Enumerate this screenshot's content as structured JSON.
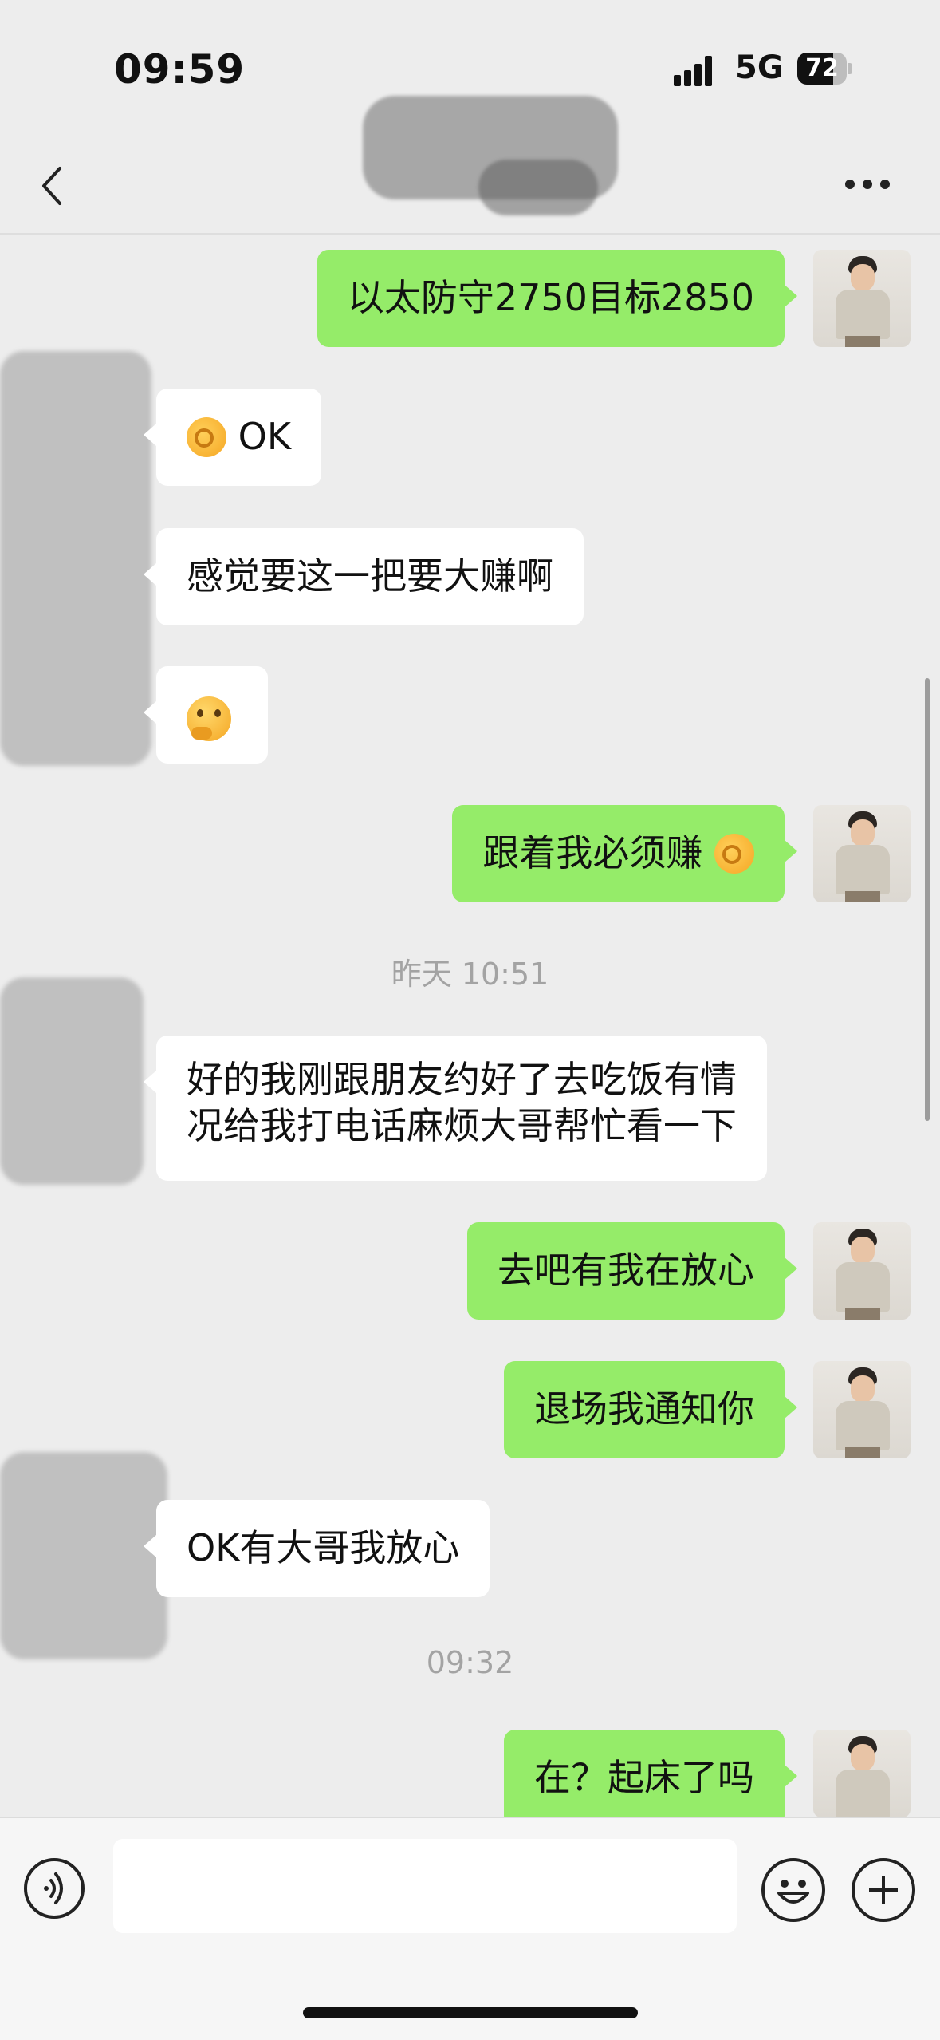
{
  "status_bar": {
    "time": "09:59",
    "network": "5G",
    "battery": "72",
    "battery_level": 0.72
  },
  "nav": {
    "contact_name": "",
    "back_icon": "chevron-left-icon",
    "more_icon": "more-dots-icon"
  },
  "messages": [
    {
      "side": "me",
      "text": "以太防守2750目标2850"
    },
    {
      "side": "them",
      "text": "OK",
      "emoji": "ok-hand"
    },
    {
      "side": "them",
      "text": "感觉要这一把要大赚啊"
    },
    {
      "side": "them",
      "text": "",
      "emoji": "thinking-face"
    },
    {
      "side": "me",
      "text": "跟着我必须赚",
      "emoji": "ok-hand"
    },
    {
      "type": "timestamp",
      "text": "昨天 10:51"
    },
    {
      "side": "them",
      "text": "好的我刚跟朋友约好了去吃饭有情",
      "text2": "况给我打电话麻烦大哥帮忙看一下"
    },
    {
      "side": "me",
      "text": "去吧有我在放心"
    },
    {
      "side": "me",
      "text": "退场我通知你"
    },
    {
      "side": "them",
      "text": "OK有大哥我放心"
    },
    {
      "type": "timestamp",
      "text": "09:32"
    },
    {
      "side": "me",
      "text": "在？起床了吗"
    }
  ],
  "input_bar": {
    "placeholder": "",
    "voice_icon": "voice-icon",
    "emoji_icon": "emoji-icon",
    "plus_icon": "plus-icon"
  }
}
